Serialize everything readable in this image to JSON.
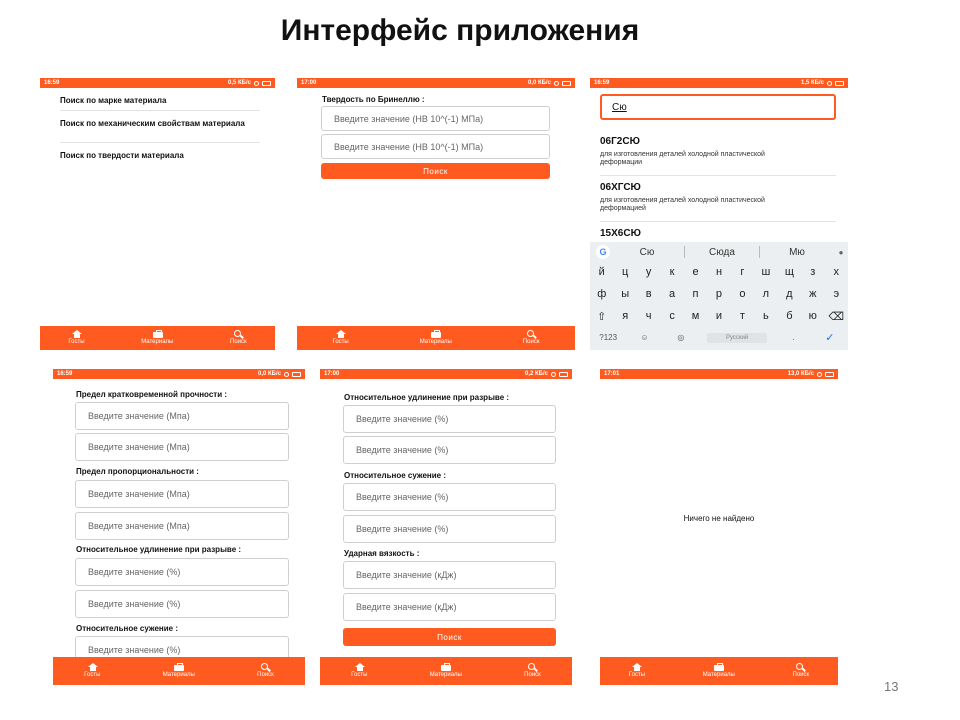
{
  "slide": {
    "title": "Интерфейс приложения",
    "page_number": "13"
  },
  "nav": {
    "items": [
      "Госты",
      "Материалы",
      "Поиск"
    ]
  },
  "screen1": {
    "status": {
      "time": "16:59",
      "speed": "0,5 КБ/с"
    },
    "menu": [
      "Поиск по марке материала",
      "Поиск по механическим свойствам материала",
      "Поиск по твердости материала"
    ]
  },
  "screen2": {
    "status": {
      "time": "17:00",
      "speed": "0,0 КБ/с"
    },
    "label": "Твердость по Бринеллю :",
    "placeholders": [
      "Введите значение (НВ 10^(-1) МПа)",
      "Введите значение (НВ 10^(-1) МПа)"
    ],
    "button": "Поиск"
  },
  "screen3": {
    "status": {
      "time": "16:59",
      "speed": "1,5 КБ/с"
    },
    "search_value": "Сю",
    "results": [
      {
        "title": "06Г2СЮ",
        "desc": "для изготовления деталей холодной пластической деформации"
      },
      {
        "title": "06ХГСЮ",
        "desc": "для изготовления деталей холодной пластической деформацией"
      },
      {
        "title": "15Х6СЮ",
        "desc": ""
      }
    ],
    "keyboard": {
      "suggestions": [
        "Сю",
        "Сюда",
        "Мю"
      ],
      "row1": [
        "й",
        "ц",
        "у",
        "к",
        "е",
        "н",
        "г",
        "ш",
        "щ",
        "з",
        "х"
      ],
      "row1_hints": [
        "1",
        "2",
        "3",
        "4",
        "5",
        "6",
        "7",
        "8",
        "9",
        "0"
      ],
      "row2": [
        "ф",
        "ы",
        "в",
        "а",
        "п",
        "р",
        "о",
        "л",
        "д",
        "ж",
        "э"
      ],
      "row3": [
        "⇧",
        "я",
        "ч",
        "с",
        "м",
        "и",
        "т",
        "ь",
        "б",
        "ю",
        "⌫"
      ],
      "symbols_key": "?123",
      "space_label": "Русский",
      "period_key": ".",
      "enter_key": "✓"
    }
  },
  "screen4": {
    "status": {
      "time": "16:59",
      "speed": "0,0 КБ/с"
    },
    "groups": [
      {
        "label": "Предел кратковременной прочности :",
        "placeholders": [
          "Введите значение (Мпа)",
          "Введите значение (Мпа)"
        ]
      },
      {
        "label": "Предел пропорциональности :",
        "placeholders": [
          "Введите значение (Мпа)",
          "Введите значение (Мпа)"
        ]
      },
      {
        "label": "Относительное удлинение при разрыве :",
        "placeholders": [
          "Введите значение (%)",
          "Введите значение (%)"
        ]
      },
      {
        "label": "Относительное сужение :",
        "placeholders": [
          "Введите значение (%)"
        ]
      }
    ]
  },
  "screen5": {
    "status": {
      "time": "17:00",
      "speed": "0,2 КБ/с"
    },
    "groups": [
      {
        "label": "Относительное удлинение при разрыве :",
        "placeholders": [
          "Введите значение (%)",
          "Введите значение (%)"
        ]
      },
      {
        "label": "Относительное сужение :",
        "placeholders": [
          "Введите значение (%)",
          "Введите значение (%)"
        ]
      },
      {
        "label": "Ударная вязкость :",
        "placeholders": [
          "Введите значение (кДж)",
          "Введите значение (кДж)"
        ]
      }
    ],
    "button": "Поиск"
  },
  "screen6": {
    "status": {
      "time": "17:01",
      "speed": "13,0 КБ/с"
    },
    "message": "Ничего не найдено"
  },
  "colors": {
    "accent": "#ff5a1f",
    "keyboard_bg": "#eceff1"
  }
}
